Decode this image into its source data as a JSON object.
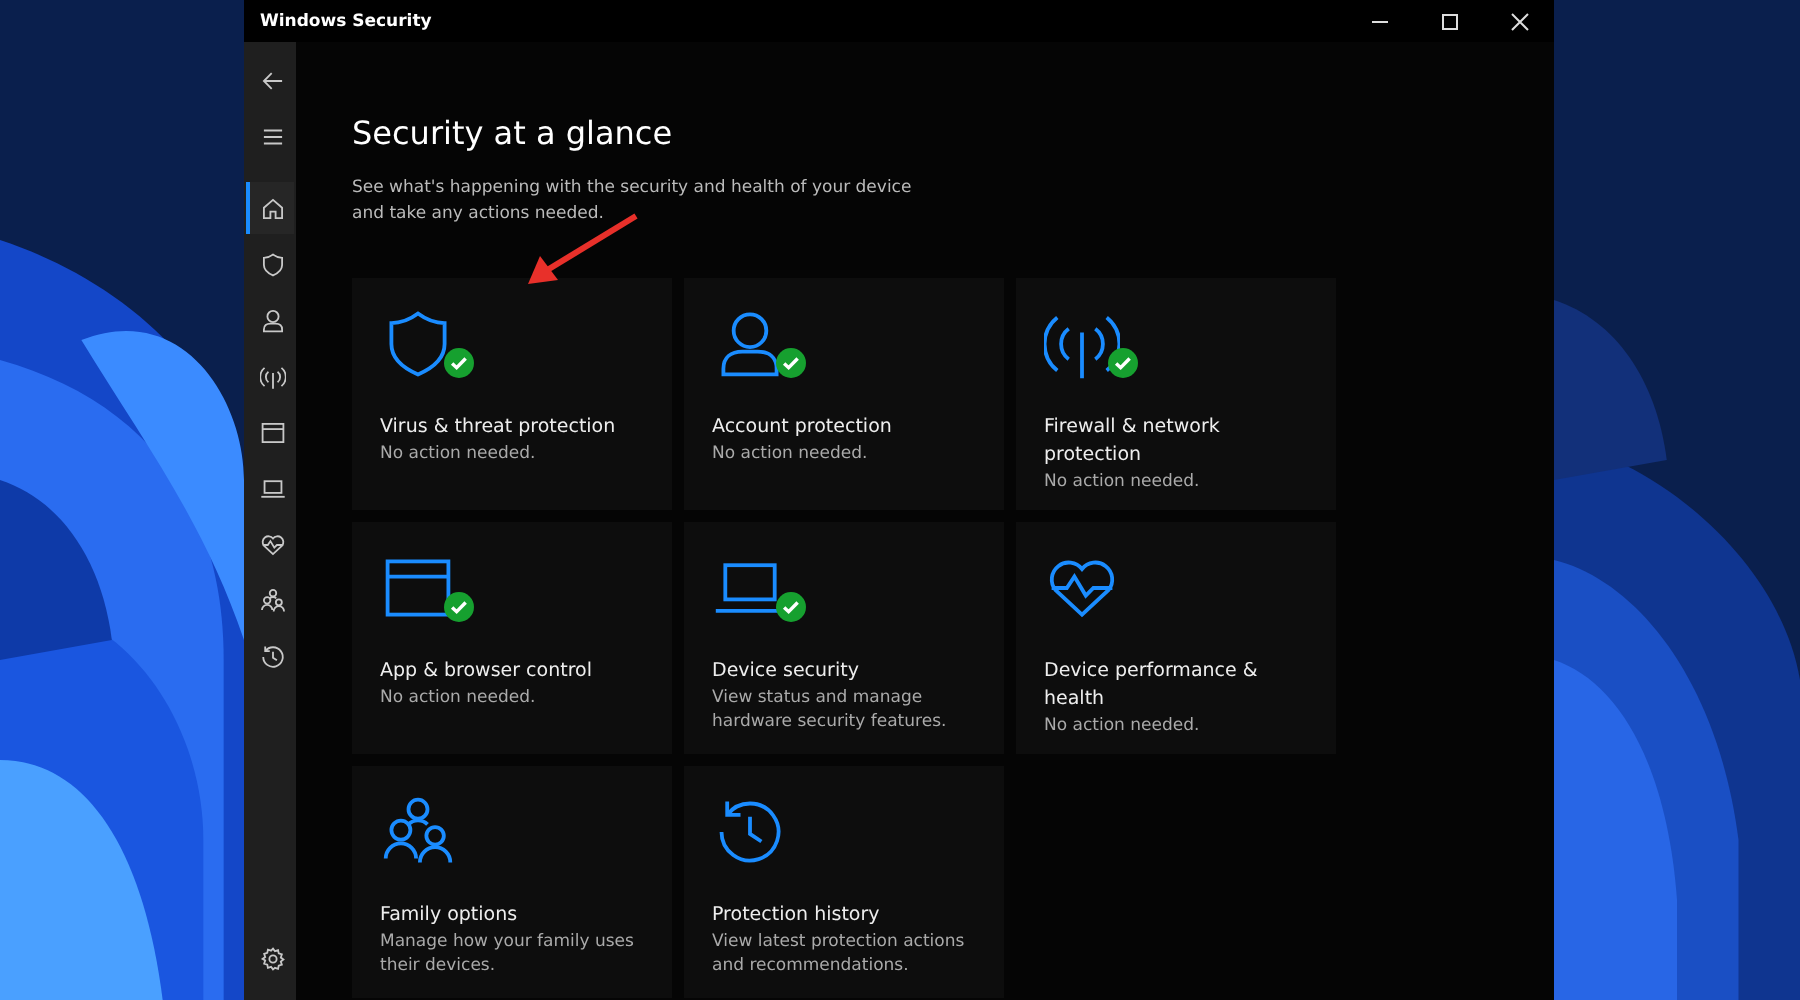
{
  "window": {
    "title": "Windows Security"
  },
  "sidebar": {
    "items": [
      {
        "kind": "back",
        "selected": false
      },
      {
        "kind": "menu",
        "selected": false
      },
      {
        "kind": "home",
        "selected": true
      },
      {
        "kind": "shield",
        "selected": false
      },
      {
        "kind": "person",
        "selected": false
      },
      {
        "kind": "antenna",
        "selected": false
      },
      {
        "kind": "browser",
        "selected": false
      },
      {
        "kind": "laptop",
        "selected": false
      },
      {
        "kind": "heart",
        "selected": false
      },
      {
        "kind": "family",
        "selected": false
      },
      {
        "kind": "history",
        "selected": false
      }
    ],
    "bottom": {
      "kind": "settings",
      "selected": false
    }
  },
  "heading": "Security at a glance",
  "subtitle": "See what's happening with the security and health of your device and take any actions needed.",
  "cards": [
    {
      "kind": "shield",
      "title": "Virus & threat protection",
      "detail": "No action needed.",
      "ok": true
    },
    {
      "kind": "person",
      "title": "Account protection",
      "detail": "No action needed.",
      "ok": true
    },
    {
      "kind": "antenna",
      "title": "Firewall & network protection",
      "detail": "No action needed.",
      "ok": true
    },
    {
      "kind": "browser",
      "title": "App & browser control",
      "detail": "No action needed.",
      "ok": true
    },
    {
      "kind": "laptop",
      "title": "Device security",
      "detail": "View status and manage hardware security features.",
      "ok": true
    },
    {
      "kind": "heart",
      "title": "Device performance & health",
      "detail": "No action needed.",
      "ok": false
    },
    {
      "kind": "family",
      "title": "Family options",
      "detail": "Manage how your family uses their devices.",
      "ok": false
    },
    {
      "kind": "history",
      "title": "Protection history",
      "detail": "View latest protection actions and recommendations.",
      "ok": false
    }
  ]
}
